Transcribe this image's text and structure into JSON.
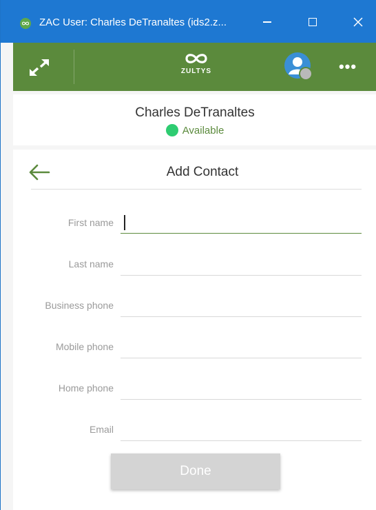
{
  "window": {
    "title": "ZAC User: Charles DeTranaltes (ids2.z..."
  },
  "toolbar": {
    "brand": "ZULTYS",
    "more_label": "•••"
  },
  "user": {
    "name": "Charles DeTranaltes",
    "status": "Available",
    "status_color": "#2ecc71"
  },
  "form": {
    "title": "Add Contact",
    "fields": [
      {
        "label": "First name",
        "value": ""
      },
      {
        "label": "Last name",
        "value": ""
      },
      {
        "label": "Business phone",
        "value": ""
      },
      {
        "label": "Mobile phone",
        "value": ""
      },
      {
        "label": "Home phone",
        "value": ""
      },
      {
        "label": "Email",
        "value": ""
      }
    ],
    "done_label": "Done"
  },
  "colors": {
    "titlebar": "#1e78d2",
    "accent_green": "#5b8a3c",
    "done_disabled": "#d4d4d4"
  }
}
